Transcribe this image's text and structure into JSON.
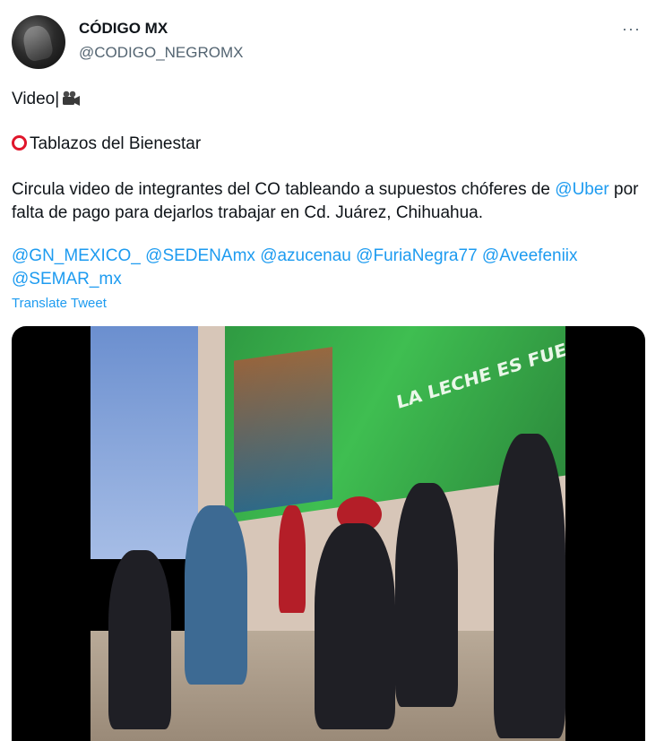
{
  "author": {
    "name": "CÓDIGO MX",
    "handle": "@CODIGO_NEGROMX"
  },
  "more_menu": "···",
  "tweet": {
    "line1": "Video",
    "line1_separator": "|",
    "line2": "Tablazos del Bienestar",
    "body_before_link": "Circula video de integrantes del CO tableando a supuestos chóferes de",
    "body_link": "@Uber",
    "body_after_link": "por falta de pago para dejarlos trabajar en Cd. Juárez, Chihuahua.",
    "mentions": [
      "@GN_MEXICO_",
      "@SEDENAmx",
      "@azucenau",
      "@FuriaNegra77",
      "@Aveefeniix",
      "@SEMAR_mx"
    ]
  },
  "translate_label": "Translate Tweet",
  "media": {
    "billboard_text": "LA LECHE ES FUENTE"
  },
  "icons": {
    "camera": "movie-camera-icon",
    "circle": "red-hollow-circle-icon"
  },
  "colors": {
    "link": "#1d9bf0",
    "secondary_text": "#536471",
    "circle_red": "#e0162b"
  }
}
